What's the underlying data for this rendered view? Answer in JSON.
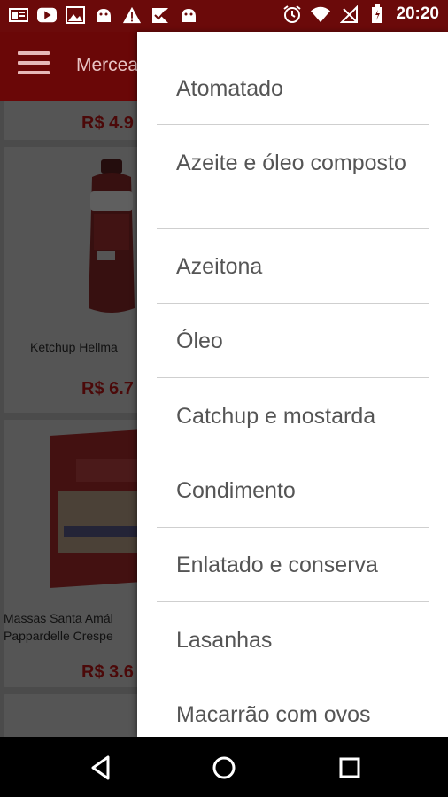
{
  "status_bar": {
    "time": "20:20",
    "left_icons": [
      "notification-icon",
      "youtube-icon",
      "image-icon",
      "android-icon",
      "warning-icon",
      "check-icon",
      "android-icon"
    ],
    "right_icons": [
      "alarm-icon",
      "wifi-icon",
      "signal-icon",
      "battery-icon"
    ]
  },
  "app_bar": {
    "title": "Mercea"
  },
  "products": [
    {
      "price": "R$ 4.9"
    },
    {
      "name": "Ketchup Hellma",
      "price": "R$ 6.7"
    },
    {
      "name_line1": "Massas Santa Amál",
      "name_line2": "Pappardelle Crespe",
      "price": "R$ 3.6"
    }
  ],
  "drawer": {
    "items": [
      {
        "label": "Atomatado"
      },
      {
        "label": "Azeite e óleo composto"
      },
      {
        "label": "Azeitona"
      },
      {
        "label": "Óleo"
      },
      {
        "label": "Catchup e mostarda"
      },
      {
        "label": "Condimento"
      },
      {
        "label": "Enlatado e conserva"
      },
      {
        "label": "Lasanhas"
      },
      {
        "label": "Macarrão com ovos"
      }
    ]
  },
  "colors": {
    "primary": "#6a0707",
    "price": "#7a1010",
    "drawer_text": "#555555"
  }
}
